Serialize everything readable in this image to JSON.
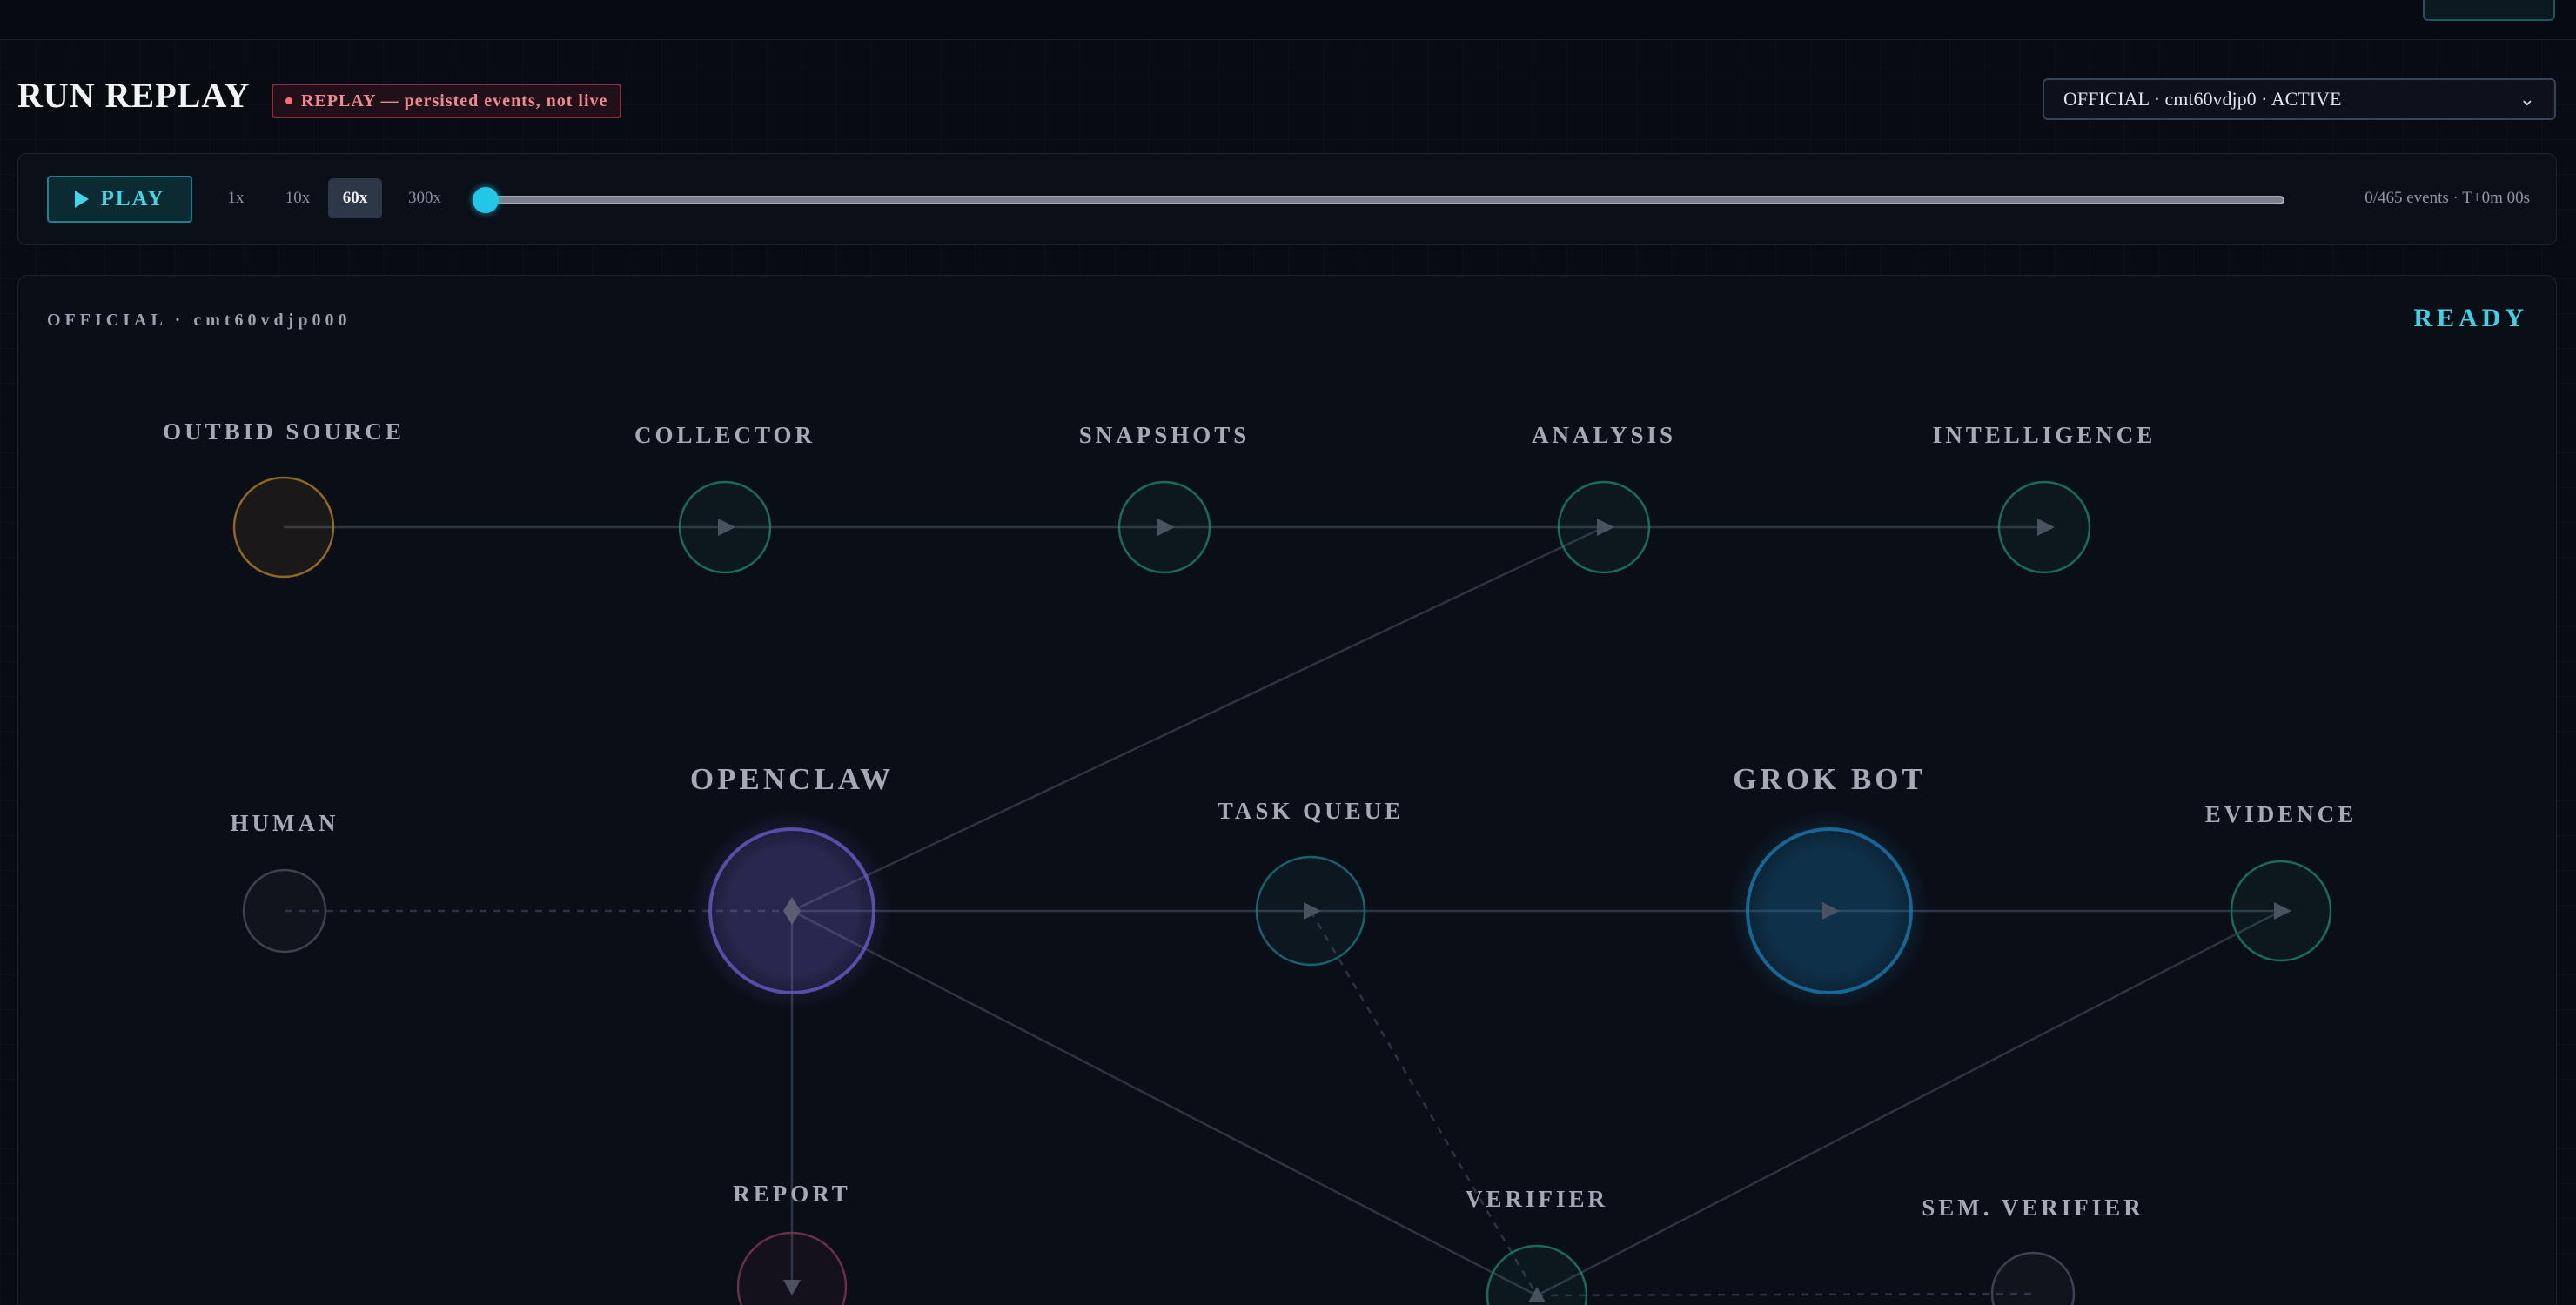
{
  "header": {
    "title": "RUN REPLAY",
    "badge": "REPLAY — persisted events, not live",
    "run_select": "OFFICIAL · cmt60vdjp0 · ACTIVE"
  },
  "controls": {
    "play_label": "PLAY",
    "speeds": [
      "1x",
      "10x",
      "60x",
      "300x"
    ],
    "active_speed": "60x",
    "progress": 0,
    "events_readout": "0/465 events · T+0m 00s"
  },
  "graph": {
    "run_id": "OFFICIAL · cmt60vdjp000",
    "status": "READY",
    "nodes": [
      {
        "id": "outbid",
        "label": "OUTBID SOURCE",
        "color": "#b8842a",
        "glyph": "none"
      },
      {
        "id": "collector",
        "label": "COLLECTOR",
        "color": "#1f8a6e",
        "glyph": "play"
      },
      {
        "id": "snapshots",
        "label": "SNAPSHOTS",
        "color": "#1f8a6e",
        "glyph": "play"
      },
      {
        "id": "analysis",
        "label": "ANALYSIS",
        "color": "#1f8a6e",
        "glyph": "play"
      },
      {
        "id": "intelligence",
        "label": "INTELLIGENCE",
        "color": "#1f8a6e",
        "glyph": "play"
      },
      {
        "id": "human",
        "label": "HUMAN",
        "color": "#4c5463",
        "glyph": "none"
      },
      {
        "id": "openclaw",
        "label": "OPENCLAW",
        "color": "#6f5fd0",
        "glyph": "diamond"
      },
      {
        "id": "taskqueue",
        "label": "TASK QUEUE",
        "color": "#1d7f88",
        "glyph": "play"
      },
      {
        "id": "grokbot",
        "label": "GROK BOT",
        "color": "#1b7fb7",
        "glyph": "play"
      },
      {
        "id": "evidence",
        "label": "EVIDENCE",
        "color": "#1f8a6e",
        "glyph": "play"
      },
      {
        "id": "report",
        "label": "REPORT",
        "color": "#8a3a55",
        "glyph": "down"
      },
      {
        "id": "verifier",
        "label": "VERIFIER",
        "color": "#1f8a6e",
        "glyph": "up"
      },
      {
        "id": "semverifier",
        "label": "SEM. VERIFIER",
        "color": "#4c5463",
        "glyph": "none"
      }
    ]
  }
}
